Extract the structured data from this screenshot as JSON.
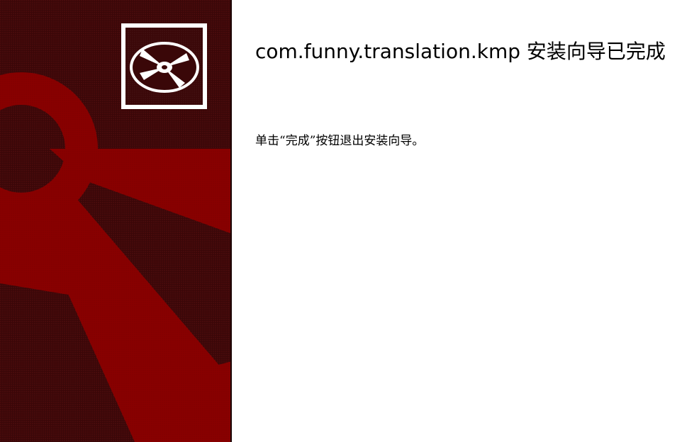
{
  "wizard": {
    "title": "com.funny.translation.kmp 安装向导已完成",
    "description": "单击“完成”按钮退出安装向导。"
  },
  "banner": {
    "background_color": "#3a0708",
    "accent_color": "#880000",
    "icon": "cd-disc-icon"
  }
}
